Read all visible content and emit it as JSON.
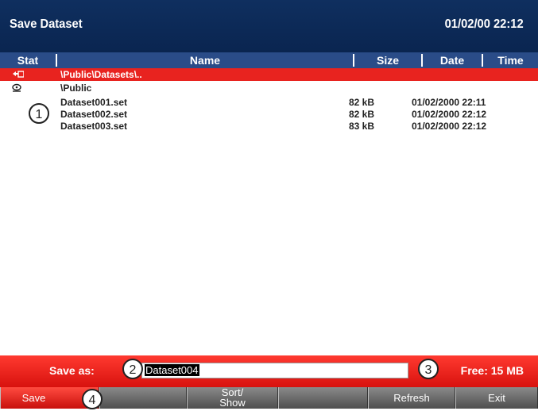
{
  "titlebar": {
    "title": "Save Dataset",
    "datetime": "01/02/00 22:12"
  },
  "columns": {
    "stat": "Stat",
    "name": "Name",
    "size": "Size",
    "date": "Date",
    "time": "Time"
  },
  "path": "\\Public\\Datasets\\..",
  "parent": "\\Public",
  "files": [
    {
      "name": "Dataset001.set",
      "size": "82 kB",
      "datetime": "01/02/2000 22:11"
    },
    {
      "name": "Dataset002.set",
      "size": "82 kB",
      "datetime": "01/02/2000 22:12"
    },
    {
      "name": "Dataset003.set",
      "size": "83 kB",
      "datetime": "01/02/2000 22:12"
    }
  ],
  "saveas": {
    "label": "Save as:",
    "value": "Dataset004",
    "free": "Free: 15 MB"
  },
  "softkeys": [
    {
      "label": "Save",
      "active": true
    },
    {
      "label": ""
    },
    {
      "label": "Sort/",
      "label2": "Show"
    },
    {
      "label": ""
    },
    {
      "label": "Refresh"
    },
    {
      "label": "Exit"
    }
  ],
  "callouts": [
    "1",
    "2",
    "3",
    "4"
  ],
  "colors": {
    "title_bg": "#0f2f5f",
    "header_bg": "#2a4c88",
    "accent_red": "#e8231f"
  }
}
